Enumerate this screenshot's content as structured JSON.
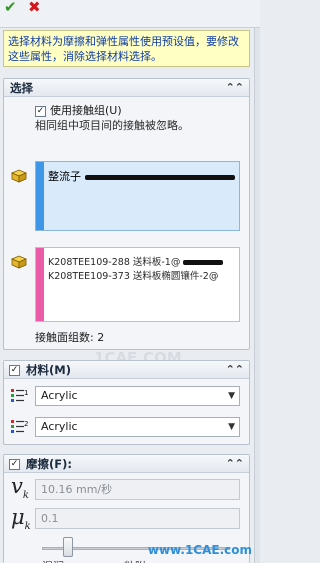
{
  "toolbar": {
    "ok_icon": "checkmark-icon",
    "cancel_icon": "close-icon"
  },
  "message": "选择材料为摩擦和弹性属性使用预设值，要修改这些属性，消除选择材料选择。",
  "selection": {
    "title": "选择",
    "use_contact_set_label": "使用接触组(U)",
    "use_contact_set_checked": true,
    "note": "相同组中项目间的接触被忽略。",
    "list1_item": "整流子",
    "list2_items": [
      "K208TEE109-288 送料板-1@",
      "K208TEE109-373 送料板椭圆镶件-2@"
    ],
    "contact_count": "接触面组数: 2"
  },
  "material": {
    "title": "材料(M)",
    "checked": true,
    "material1": "Acrylic",
    "material2": "Acrylic"
  },
  "friction": {
    "title": "摩擦(F):",
    "checked": true,
    "velocity_symbol": "v",
    "velocity_value": "10.16 mm/秒",
    "coef_symbol": "μ",
    "coef_value": "0.1",
    "slider_left": "湿润",
    "slider_right": "粘附",
    "slider_fraction": 0.12
  },
  "watermark": "www.1CAE.com",
  "watermark_center": "1CAE.COM",
  "colors": {
    "accent_blue": "#3d97e6",
    "accent_pink": "#ea5ca7",
    "message_text": "#0e3ca8"
  }
}
